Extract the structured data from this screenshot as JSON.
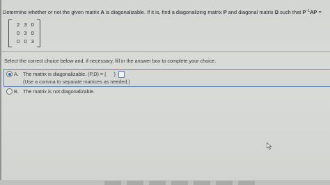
{
  "question": {
    "prefix": "Determine whether or not the given matrix ",
    "matrix_name": "A",
    "middle": " is diagonalizable. If it is, find a diagonalizing matrix ",
    "p_name": "P",
    "and_text": " and diagonal matrix ",
    "d_name": "D",
    "tail": " such that ",
    "expr_p": "P",
    "expr_sup": "−1",
    "expr_ap": "AP",
    "expr_eq": " ="
  },
  "matrix": {
    "rows": [
      "2 3 0",
      "0 3 0",
      "0 0 3"
    ]
  },
  "instructions": "Select the correct choice below and, if necessary, fill in the answer box to complete your choice.",
  "choices": {
    "a": {
      "letter": "A.",
      "text": "The matrix is diagonalizable. (P,D) = (",
      "close": ")",
      "hint": "(Use a comma to separate matrices as needed.)",
      "selected": true
    },
    "b": {
      "letter": "B.",
      "text": "The matrix is not diagonalizable.",
      "selected": false
    }
  },
  "icons": {
    "cursor": "mouse-pointer-icon"
  },
  "colors": {
    "selection_border": "#5d7fb8",
    "radio_selected": "#3a66b0",
    "answer_box_border": "#5b7fc4"
  }
}
